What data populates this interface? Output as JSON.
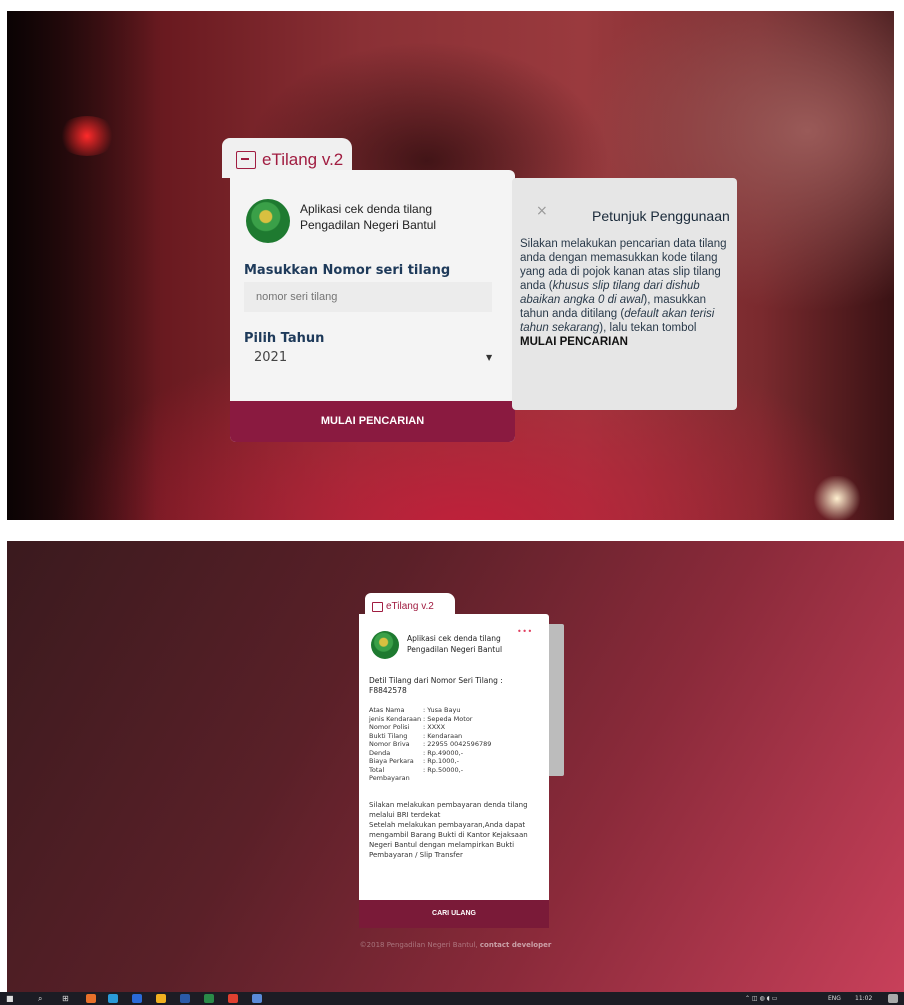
{
  "top_photo": {
    "tab_title": "eTilang v.2",
    "app_line1": "Aplikasi cek denda tilang",
    "app_line2": "Pengadilan Negeri Bantul",
    "label_seri": "Masukkan Nomor seri tilang",
    "seri_placeholder": "nomor seri tilang",
    "label_tahun": "Pilih Tahun",
    "tahun_value": "2021",
    "mulai_button": "MULAI PENCARIAN",
    "petunjuk": {
      "close": "×",
      "title": "Petunjuk Penggunaan",
      "p1": "Silakan melakukan pencarian data tilang anda dengan memasukkan kode tilang yang ada di pojok kanan atas slip tilang anda (",
      "p1_italic": "khusus slip tilang dari dishub abaikan angka 0 di awal",
      "p2": "), masukkan tahun anda ditilang (",
      "p2_italic": "default akan terisi tahun sekarang",
      "p3": "), lalu tekan tombol",
      "p3_bold": "MULAI PENCARIAN"
    }
  },
  "bottom_screen": {
    "tab_title": "eTilang v.2",
    "app_line1": "Aplikasi cek denda tilang",
    "app_line2": "Pengadilan Negeri Bantul",
    "dots": "•••",
    "detil_title": "Detil Tilang dari Nomor Seri Tilang :",
    "detil_number": "F8842578",
    "rows": [
      {
        "k": "Atas Nama",
        "v": ": Yusa Bayu"
      },
      {
        "k": "jenis Kendaraan",
        "v": ": Sepeda Motor"
      },
      {
        "k": "Nomor Polisi",
        "v": ": XXXX"
      },
      {
        "k": "Bukti Tilang",
        "v": ": Kendaraan"
      },
      {
        "k": "Nomor Briva",
        "v": ": 22955 0042596789"
      },
      {
        "k": "Denda",
        "v": ": Rp.49000,-"
      },
      {
        "k": "Biaya Perkara",
        "v": ": Rp.1000,-"
      },
      {
        "k": "Total Pembayaran",
        "v": ": Rp.50000,-"
      }
    ],
    "note1": "Silakan melakukan pembayaran denda tilang melalui BRI terdekat",
    "note2": "Setelah melakukan pembayaran,Anda dapat mengambil Barang Bukti di Kantor Kejaksaan Negeri Bantul dengan melampirkan Bukti Pembayaran / Slip Transfer",
    "cari_button": "CARI ULANG",
    "footer_text": "©2018 Pengadilan Negeri Bantul,",
    "footer_link": "contact developer"
  },
  "taskbar": {
    "lang": "ENG",
    "time": "11:02"
  }
}
